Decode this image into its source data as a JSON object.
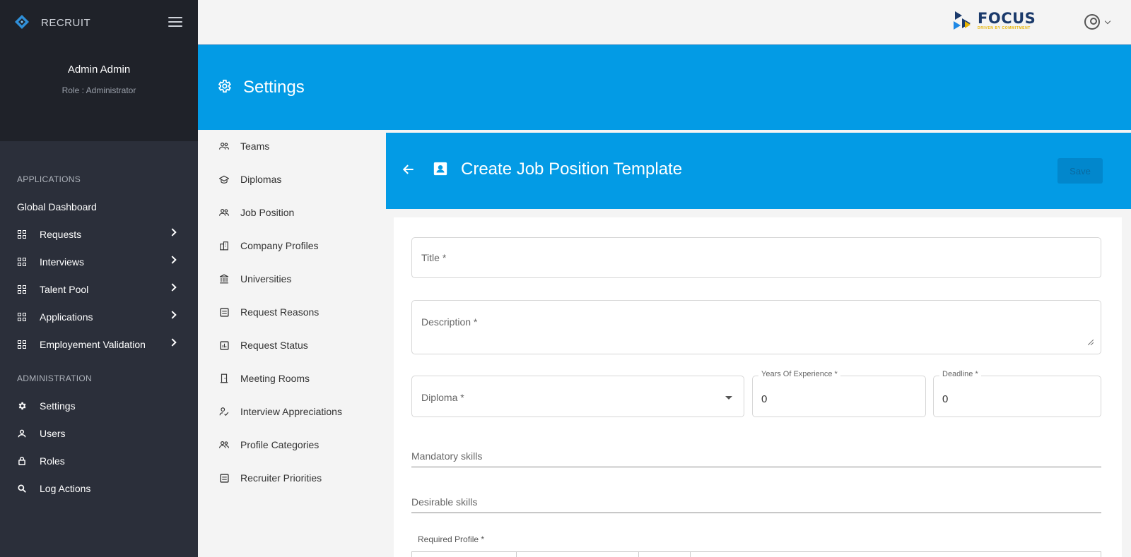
{
  "sidebar": {
    "brand": "RECRUIT",
    "user_name": "Admin Admin",
    "user_role": "Role : Administrator",
    "section_applications": "APPLICATIONS",
    "global_dashboard": "Global Dashboard",
    "app_items": [
      {
        "label": "Requests",
        "icon": "grid-icon"
      },
      {
        "label": "Interviews",
        "icon": "grid-icon"
      },
      {
        "label": "Talent Pool",
        "icon": "grid-icon"
      },
      {
        "label": "Applications",
        "icon": "grid-icon"
      },
      {
        "label": "Employement Validation",
        "icon": "grid-icon"
      }
    ],
    "section_administration": "ADMINISTRATION",
    "admin_items": [
      {
        "label": "Settings",
        "icon": "gear-icon"
      },
      {
        "label": "Users",
        "icon": "user-icon"
      },
      {
        "label": "Roles",
        "icon": "lock-icon"
      },
      {
        "label": "Log Actions",
        "icon": "search-icon"
      }
    ]
  },
  "topbar": {
    "logo_word": "FOCUS",
    "logo_tagline": "DRIVEN BY COMMITMENT"
  },
  "settings": {
    "title": "Settings",
    "nav": [
      {
        "label": "Teams",
        "icon": "people-icon"
      },
      {
        "label": "Diplomas",
        "icon": "graduation-cap-icon"
      },
      {
        "label": "Job Position",
        "icon": "people-icon"
      },
      {
        "label": "Company Profiles",
        "icon": "building-icon"
      },
      {
        "label": "Universities",
        "icon": "institution-icon"
      },
      {
        "label": "Request Reasons",
        "icon": "list-icon"
      },
      {
        "label": "Request Status",
        "icon": "chart-icon"
      },
      {
        "label": "Meeting Rooms",
        "icon": "door-icon"
      },
      {
        "label": "Interview Appreciations",
        "icon": "person-check-icon"
      },
      {
        "label": "Profile Categories",
        "icon": "people-icon"
      },
      {
        "label": "Recruiter Priorities",
        "icon": "list-icon"
      }
    ]
  },
  "form": {
    "header_title": "Create Job Position Template",
    "save_label": "Save",
    "title_placeholder": "Title *",
    "description_placeholder": "Description *",
    "diploma_placeholder": "Diploma *",
    "years_label": "Years Of Experience *",
    "years_value": "0",
    "deadline_label": "Deadline *",
    "deadline_value": "0",
    "mandatory_skills": "Mandatory skills",
    "desirable_skills": "Desirable skills",
    "required_profile": "Required Profile *"
  },
  "colors": {
    "primary": "#039be5",
    "sidebar_bg": "#2b2f3a",
    "sidebar_top_bg": "#1f2229",
    "logo_navy": "#1b3a6b",
    "logo_yellow": "#e8b400"
  }
}
